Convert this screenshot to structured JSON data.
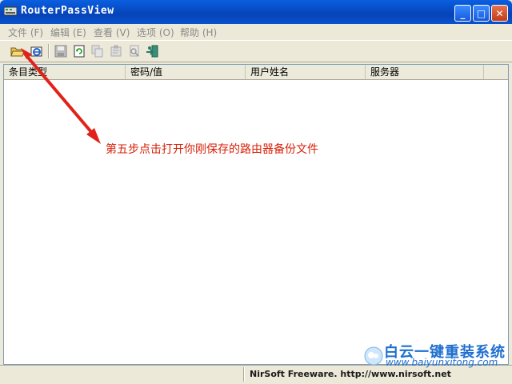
{
  "window": {
    "title": "RouterPassView",
    "minimize_label": "_",
    "maximize_label": "□",
    "close_label": "✕"
  },
  "menu": {
    "items": [
      {
        "label": "文件 (F)"
      },
      {
        "label": "编辑 (E)"
      },
      {
        "label": "查看 (V)"
      },
      {
        "label": "选项 (O)"
      },
      {
        "label": "帮助 (H)"
      }
    ]
  },
  "toolbar": {
    "icons": [
      "open-folder-icon",
      "open-ie-icon",
      "save-icon",
      "refresh-icon",
      "copy-icon",
      "properties-icon",
      "find-icon",
      "exit-icon"
    ]
  },
  "table": {
    "columns": [
      {
        "label": "条目类型"
      },
      {
        "label": "密码/值"
      },
      {
        "label": "用户姓名"
      },
      {
        "label": "服务器"
      }
    ],
    "rows": []
  },
  "annotation": {
    "text": "第五步点击打开你刚保存的路由器备份文件"
  },
  "statusbar": {
    "text": "NirSoft Freeware.  http://www.nirsoft.net"
  },
  "watermark": {
    "title": "白云一键重装系统",
    "url": "www.baiyunxitong.com"
  },
  "colors": {
    "titlebar": "#0a5fe0",
    "annotation": "#d81e06",
    "watermark": "#1e6fd0"
  }
}
